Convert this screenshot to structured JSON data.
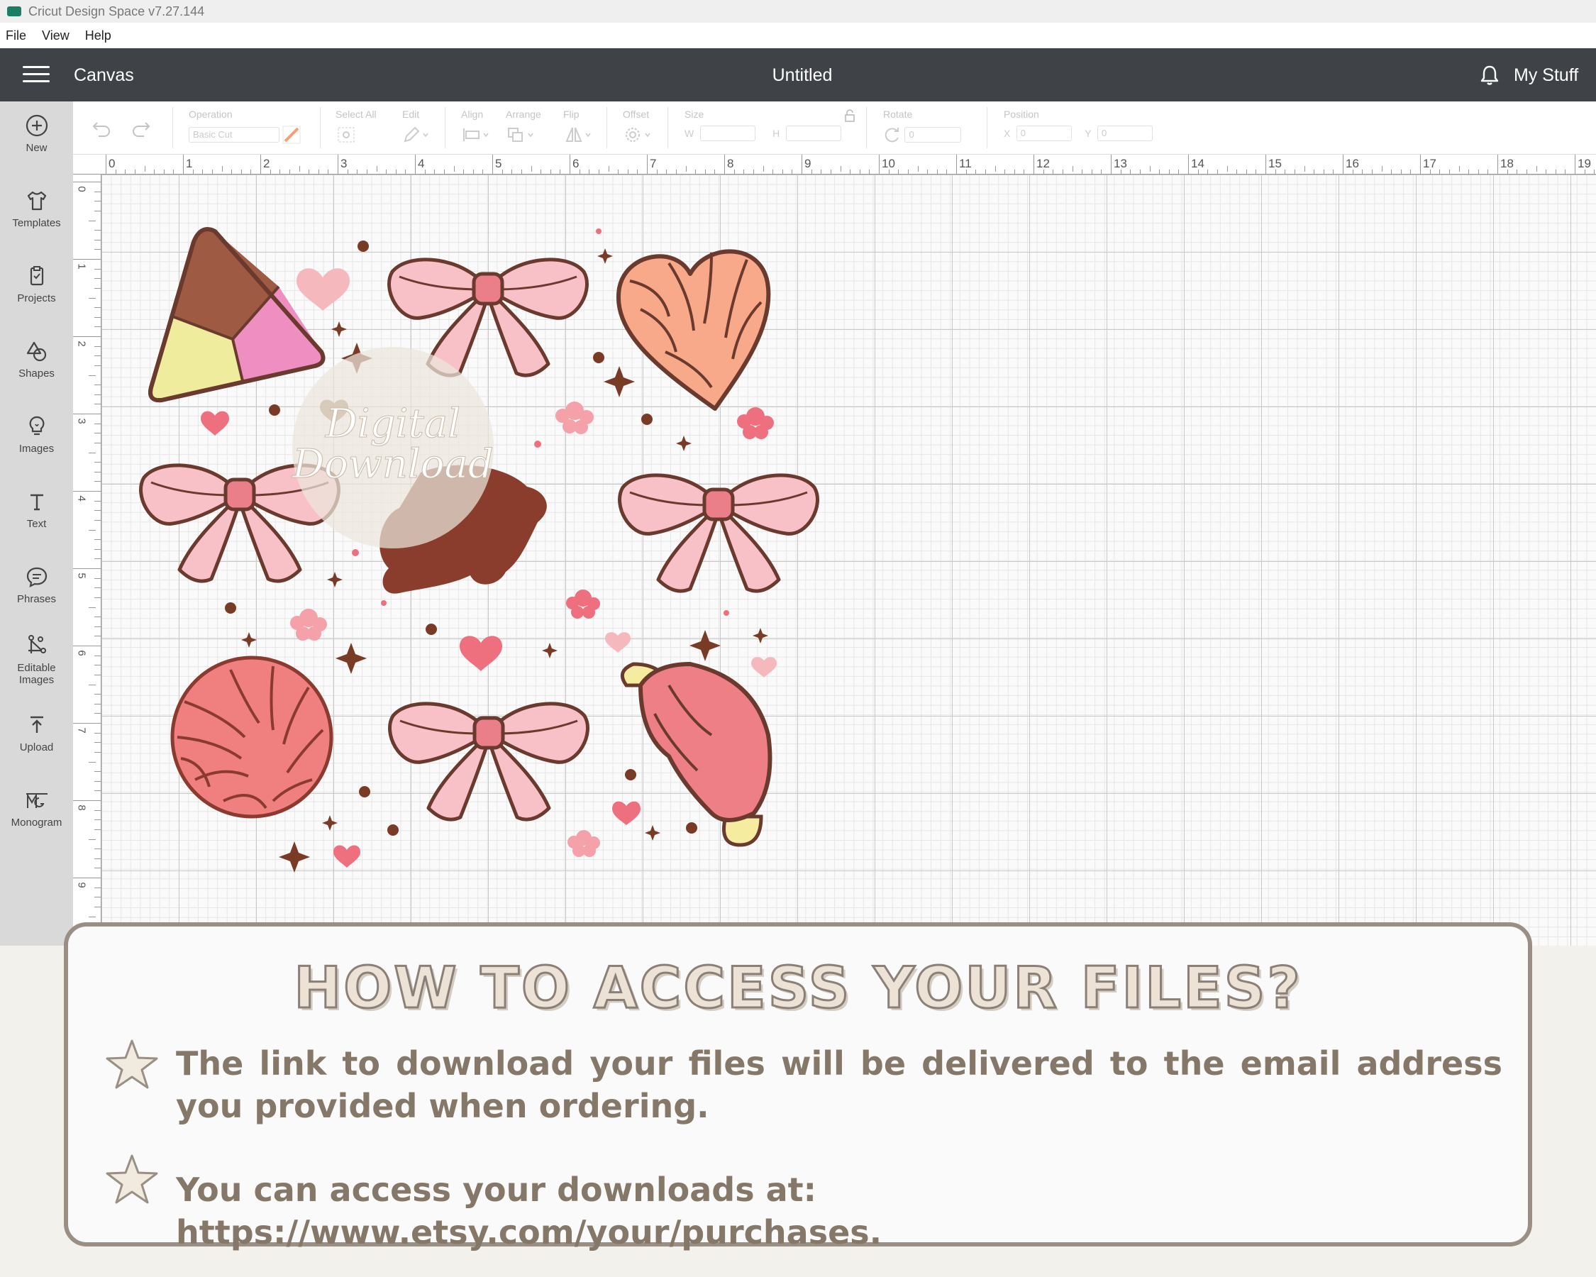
{
  "window": {
    "title": "Cricut Design Space  v7.27.144"
  },
  "menu": {
    "items": [
      "File",
      "View",
      "Help"
    ]
  },
  "header": {
    "section": "Canvas",
    "document_title": "Untitled",
    "my_stuff": "My Stuff"
  },
  "sidebar": {
    "items": [
      {
        "label": "New",
        "icon": "plus-circle-icon"
      },
      {
        "label": "Templates",
        "icon": "tshirt-icon"
      },
      {
        "label": "Projects",
        "icon": "clipboard-icon"
      },
      {
        "label": "Shapes",
        "icon": "shapes-icon"
      },
      {
        "label": "Images",
        "icon": "lightbulb-icon"
      },
      {
        "label": "Text",
        "icon": "text-t-icon"
      },
      {
        "label": "Phrases",
        "icon": "speech-bubble-icon"
      },
      {
        "label": "Editable",
        "label2": "Images",
        "icon": "editable-images-icon"
      },
      {
        "label": "Upload",
        "icon": "upload-arrow-icon"
      },
      {
        "label": "Monogram",
        "icon": "monogram-icon"
      }
    ]
  },
  "toolbar": {
    "operation_label": "Operation",
    "operation_value": "Basic Cut",
    "select_all_label": "Select All",
    "edit_label": "Edit",
    "align_label": "Align",
    "arrange_label": "Arrange",
    "flip_label": "Flip",
    "offset_label": "Offset",
    "size_label": "Size",
    "size_w": "W",
    "size_h": "H",
    "rotate_label": "Rotate",
    "rotate_value": "0",
    "position_label": "Position",
    "pos_x": "X",
    "pos_x_value": "0",
    "pos_y": "Y",
    "pos_y_value": "0"
  },
  "rulers": {
    "top": [
      "0",
      "1",
      "2",
      "3",
      "4",
      "5",
      "6",
      "7",
      "8",
      "9",
      "10",
      "11",
      "12",
      "13",
      "14",
      "15",
      "16",
      "17",
      "18",
      "19"
    ],
    "left": [
      "0",
      "1",
      "2",
      "3",
      "4",
      "5",
      "6",
      "7",
      "8",
      "9"
    ]
  },
  "watermark": {
    "line1": "Digital",
    "line2": "Download"
  },
  "info_panel": {
    "heading": "HOW TO ACCESS YOUR FILES?",
    "line1": "The link to download your files will be delivered to the email address you provided when ordering.",
    "line2": "You can access your downloads at: https://www.etsy.com/your/purchases."
  },
  "colors": {
    "header_bg": "#3f4347",
    "sidebar_bg": "#d9d9d9",
    "panel_border": "#9a8f84",
    "panel_text": "#857869"
  }
}
